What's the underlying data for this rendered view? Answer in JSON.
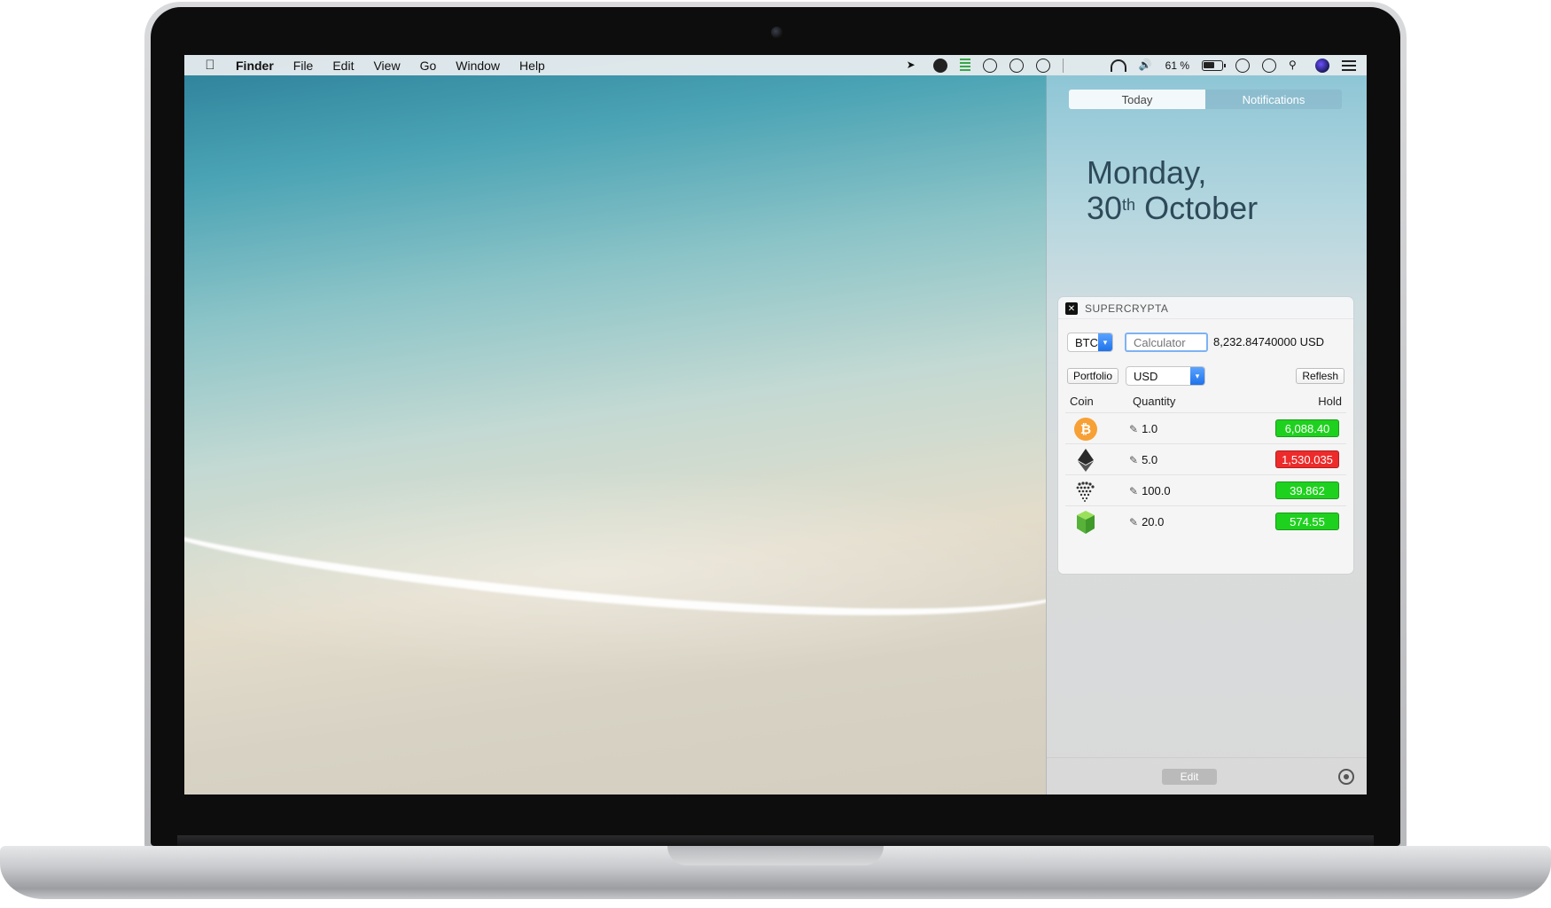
{
  "menubar": {
    "app_name": "Finder",
    "menus": [
      "File",
      "Edit",
      "View",
      "Go",
      "Window",
      "Help"
    ],
    "battery_percent": "61 %"
  },
  "notification_center": {
    "tabs": [
      {
        "label": "Today",
        "active": true
      },
      {
        "label": "Notifications",
        "active": false
      }
    ],
    "date_line1": "Monday,",
    "date_day": "30",
    "date_suffix": "th",
    "date_month": "October",
    "widget": {
      "title": "SUPERCRYPTA",
      "coin_select": "BTC",
      "calculator_placeholder": "Calculator",
      "converted_value": "8,232.84740000 USD",
      "portfolio_button": "Portfolio",
      "currency_select": "USD",
      "refresh_button": "Reflesh",
      "columns": {
        "coin": "Coin",
        "quantity": "Quantity",
        "hold": "Hold"
      },
      "rows": [
        {
          "coin": "bitcoin",
          "quantity": "1.0",
          "hold": "6,088.40",
          "status": "up",
          "color": "#1fd11f"
        },
        {
          "coin": "ethereum",
          "quantity": "5.0",
          "hold": "1,530.035",
          "status": "down",
          "color": "#ee2b2b"
        },
        {
          "coin": "iota",
          "quantity": "100.0",
          "hold": "39.862",
          "status": "up",
          "color": "#1fd11f"
        },
        {
          "coin": "neo",
          "quantity": "20.0",
          "hold": "574.55",
          "status": "up",
          "color": "#1fd11f"
        }
      ]
    },
    "footer": {
      "edit_button": "Edit"
    }
  }
}
